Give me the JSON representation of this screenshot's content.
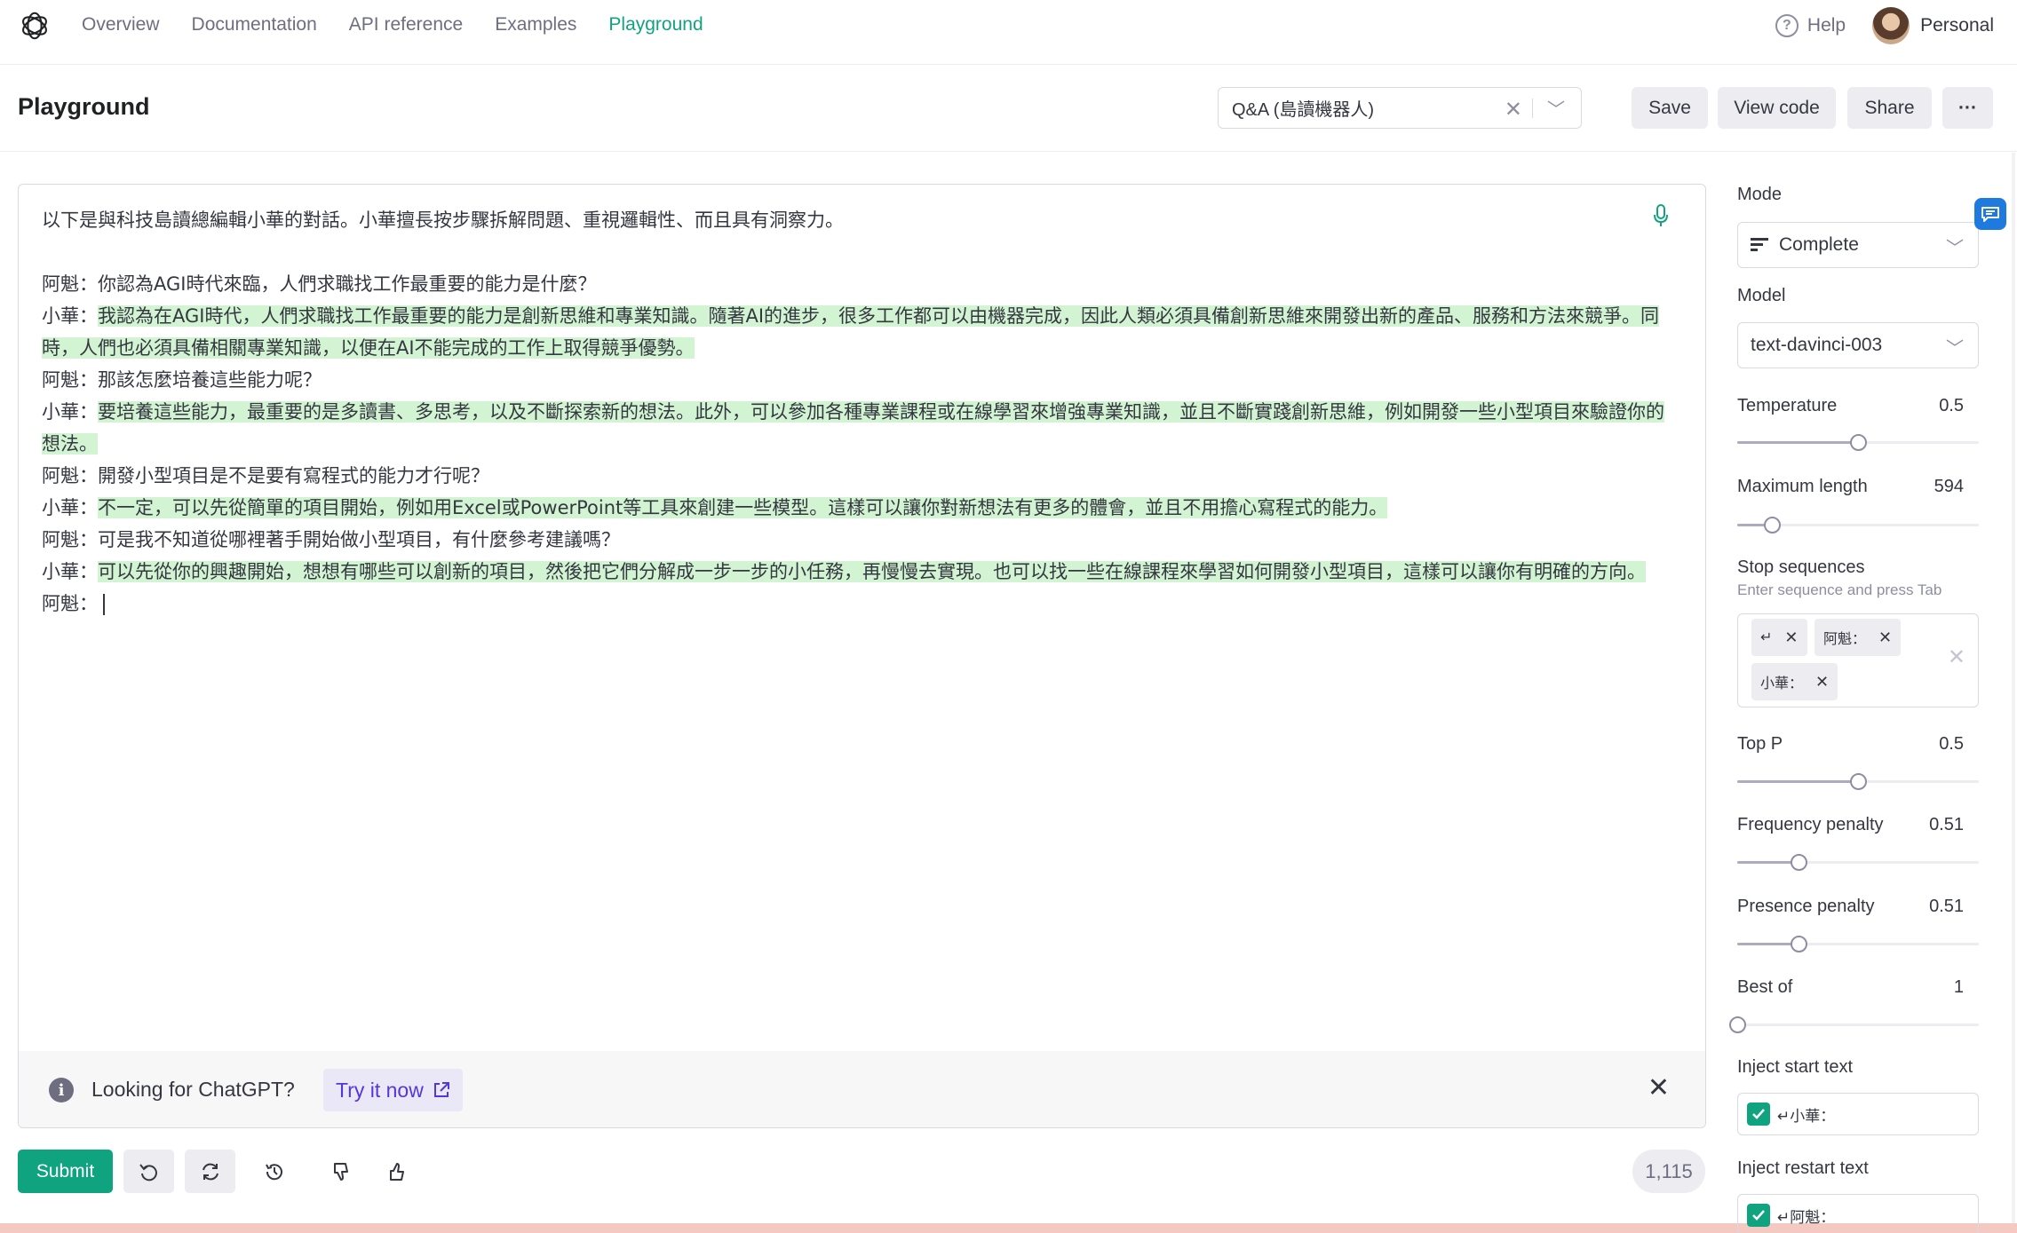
{
  "nav": {
    "links": [
      "Overview",
      "Documentation",
      "API reference",
      "Examples",
      "Playground"
    ],
    "active": "Playground",
    "help": "Help",
    "account": "Personal"
  },
  "header": {
    "title": "Playground",
    "preset": "Q&A (島讀機器人)",
    "save": "Save",
    "view_code": "View code",
    "share": "Share",
    "more": "···"
  },
  "editor": {
    "lines": [
      {
        "prefix": "以下是與科技島讀總編輯小華的對話。小華擅長按步驟拆解問題、重視邏輯性、而且具有洞察力。",
        "text": ""
      },
      {
        "prefix": "",
        "text": ""
      },
      {
        "prefix": "阿魁：你認為AGI時代來臨，人們求職找工作最重要的能力是什麼？",
        "text": ""
      },
      {
        "prefix": "小華：",
        "text": "我認為在AGI時代，人們求職找工作最重要的能力是創新思維和專業知識。隨著AI的進步，很多工作都可以由機器完成，因此人類必須具備創新思維來開發出新的產品、服務和方法來競爭。同時，人們也必須具備相關專業知識，以便在AI不能完成的工作上取得競爭優勢。"
      },
      {
        "prefix": "阿魁：那該怎麼培養這些能力呢？",
        "text": ""
      },
      {
        "prefix": "小華：",
        "text": "要培養這些能力，最重要的是多讀書、多思考，以及不斷探索新的想法。此外，可以參加各種專業課程或在線學習來增強專業知識，並且不斷實踐創新思維，例如開發一些小型項目來驗證你的想法。"
      },
      {
        "prefix": "阿魁：開發小型項目是不是要有寫程式的能力才行呢？",
        "text": ""
      },
      {
        "prefix": "小華：",
        "text": "不一定，可以先從簡單的項目開始，例如用Excel或PowerPoint等工具來創建一些模型。這樣可以讓你對新想法有更多的體會，並且不用擔心寫程式的能力。"
      },
      {
        "prefix": "阿魁：可是我不知道從哪裡著手開始做小型項目，有什麼參考建議嗎？",
        "text": ""
      },
      {
        "prefix": "小華：",
        "text": "可以先從你的興趣開始，想想有哪些可以創新的項目，然後把它們分解成一步一步的小任務，再慢慢去實現。也可以找一些在線課程來學習如何開發小型項目，這樣可以讓你有明確的方向。"
      },
      {
        "prefix": "阿魁：",
        "text": ""
      }
    ]
  },
  "banner": {
    "text": "Looking for ChatGPT?",
    "cta": "Try it now"
  },
  "toolbar": {
    "submit": "Submit",
    "token_count": "1,115"
  },
  "settings": {
    "mode_label": "Mode",
    "mode_value": "Complete",
    "model_label": "Model",
    "model_value": "text-davinci-003",
    "temperature": {
      "label": "Temperature",
      "value": "0.5",
      "fraction": 0.5
    },
    "max_length": {
      "label": "Maximum length",
      "value": "594",
      "fraction": 0.145
    },
    "stop_label": "Stop sequences",
    "stop_hint": "Enter sequence and press Tab",
    "stop_chips": [
      "↵",
      "阿魁：",
      "小華："
    ],
    "top_p": {
      "label": "Top P",
      "value": "0.5",
      "fraction": 0.5
    },
    "frequency_penalty": {
      "label": "Frequency penalty",
      "value": "0.51",
      "fraction": 0.255
    },
    "presence_penalty": {
      "label": "Presence penalty",
      "value": "0.51",
      "fraction": 0.255
    },
    "best_of": {
      "label": "Best of",
      "value": "1",
      "fraction": 0.0
    },
    "inject_start_label": "Inject start text",
    "inject_start_value": "↵小華：",
    "inject_restart_label": "Inject restart text",
    "inject_restart_value": "↵阿魁："
  },
  "colors": {
    "accent": "#10a37f",
    "highlight": "#d2f4d3",
    "link": "#5436da"
  }
}
